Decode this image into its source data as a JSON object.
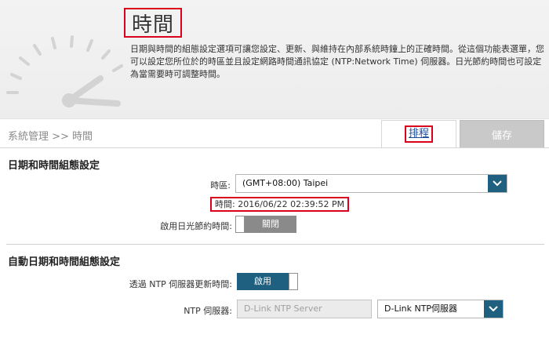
{
  "header": {
    "title": "時間",
    "description": "日期與時間的組態設定選項可讓您設定、更新、與維持在內部系統時鐘上的正確時間。從這個功能表選單，您可以設定您所位於的時區並且設定網路時間通訊協定 (NTP:Network Time) 伺服器。日光節約時間也可設定為當需要時可調整時間。"
  },
  "nav": {
    "breadcrumb": "系統管理 >> 時間",
    "schedule_label": "排程",
    "save_label": "儲存"
  },
  "date_time": {
    "section_title": "日期和時間組態設定",
    "timezone_label": "時區:",
    "timezone_value": "(GMT+08:00) Taipei",
    "current_time": "時間: 2016/06/22 02:39:52 PM",
    "dst_label": "啟用日光節約時間:",
    "dst_toggle_text": "關閉"
  },
  "auto": {
    "section_title": "自動日期和時間組態設定",
    "ntp_update_label": "透過 NTP 伺服器更新時間:",
    "ntp_toggle_text": "啟用",
    "ntp_server_label": "NTP 伺服器:",
    "ntp_server_placeholder": "D-Link NTP Server",
    "ntp_server_select": "D-Link NTP伺服器"
  },
  "colors": {
    "accent_teal": "#1f5f7f",
    "toggle_off": "#8a8a8a",
    "highlight_red": "#d9001b",
    "save_disabled": "#c9c9c9"
  },
  "icons": [
    "clock-illustration",
    "chevron-down-icon"
  ]
}
